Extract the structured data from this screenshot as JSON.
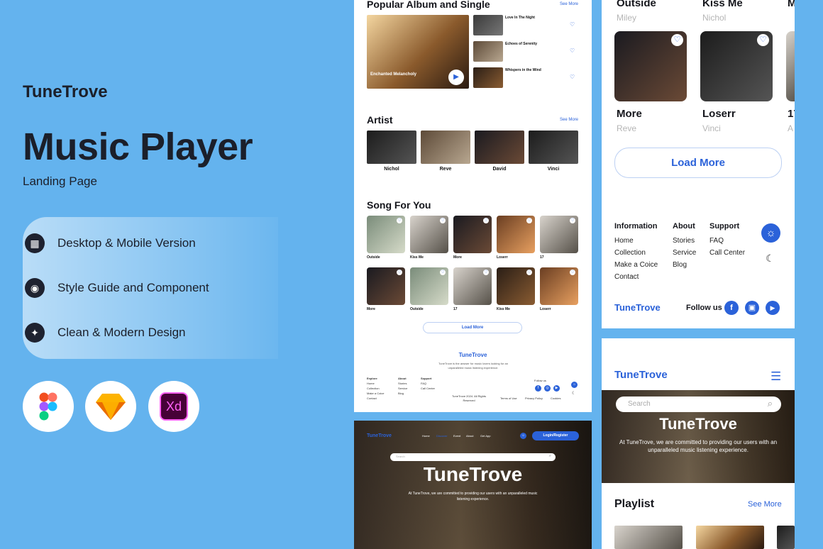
{
  "promo": {
    "brand": "TuneTrove",
    "title": "Music Player",
    "subtitle": "Landing Page",
    "features": [
      {
        "icon": "grid-icon",
        "label": "Desktop & Mobile Version"
      },
      {
        "icon": "palette-icon",
        "label": "Style Guide and Component"
      },
      {
        "icon": "sparkle-icon",
        "label": "Clean & Modern Design"
      }
    ],
    "tools": [
      {
        "icon": "figma-icon"
      },
      {
        "icon": "sketch-icon"
      },
      {
        "icon": "xd-icon",
        "label": "Xd"
      }
    ]
  },
  "desktop": {
    "popular": {
      "title": "Popular Album and Single",
      "see_more": "See More",
      "featured": "Enchanted Melancholy",
      "tracks": [
        {
          "name": "Love In The Night"
        },
        {
          "name": "Echoes of Serenity"
        },
        {
          "name": "Whispers in the Wind"
        }
      ]
    },
    "artist": {
      "title": "Artist",
      "see_more": "See More",
      "items": [
        "Nichol",
        "Reve",
        "David",
        "Vinci"
      ]
    },
    "songs": {
      "title": "Song For You",
      "row1": [
        "Outside",
        "Kiss Me",
        "More",
        "Loserr",
        "17"
      ],
      "row2": [
        "More",
        "Outside",
        "17",
        "Kiss Me",
        "Loserr"
      ],
      "load_more": "Load More"
    },
    "footer": {
      "brand": "TuneTrove",
      "tagline": "TuneTrove is the answer for music lovers looking for an unparalleled music listening experience.",
      "explore": {
        "title": "Explore",
        "items": [
          "Home",
          "Collection",
          "Make a Coice",
          "Contact"
        ]
      },
      "about": {
        "title": "About",
        "items": [
          "Stories",
          "Service",
          "Blog"
        ]
      },
      "support": {
        "title": "Support",
        "items": [
          "FAQ",
          "Call Center"
        ]
      },
      "follow": "Follow us",
      "copyright": "TuneTrove 2024. All Rights Reserved",
      "links": [
        "Terms of Use",
        "Privacy Policy",
        "Cookies"
      ]
    },
    "hero": {
      "brand": "TuneTrove",
      "nav": [
        "Home",
        "Discover",
        "Event",
        "About",
        "Get App"
      ],
      "login": "Login/Register",
      "search_placeholder": "Search",
      "title": "TuneTrove",
      "text": "At TuneTrove, we are committed to providing our users with an unparalleled music listening experience."
    }
  },
  "mobile_top": {
    "row1": [
      {
        "name": "Outside",
        "artist": "Miley"
      },
      {
        "name": "Kiss Me",
        "artist": "Nichol"
      }
    ],
    "row2": [
      {
        "name": "More",
        "artist": "Reve"
      },
      {
        "name": "Loserr",
        "artist": "Vinci"
      }
    ],
    "load_more": "Load More",
    "info": {
      "title": "Information",
      "items": [
        "Home",
        "Collection",
        "Make a Coice",
        "Contact"
      ]
    },
    "about": {
      "title": "About",
      "items": [
        "Stories",
        "Service",
        "Blog"
      ]
    },
    "support": {
      "title": "Support",
      "items": [
        "FAQ",
        "Call Center"
      ]
    },
    "brand": "TuneTrove",
    "follow": "Follow us"
  },
  "mobile_bottom": {
    "brand": "TuneTrove",
    "search_placeholder": "Search",
    "hero_title": "TuneTrove",
    "hero_text": "At TuneTrove, we are committed to providing our users with an unparalleled music listening experience.",
    "playlist": "Playlist",
    "see_more": "See More"
  },
  "colors": {
    "accent": "#2b62d9",
    "background": "#64b3ee"
  }
}
